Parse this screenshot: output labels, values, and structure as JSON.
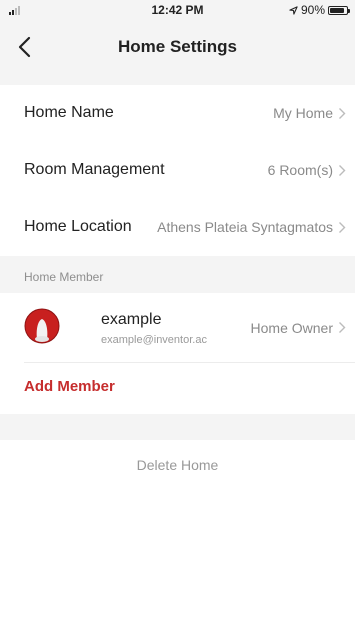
{
  "status_bar": {
    "time": "12:42 PM",
    "battery_text": "90%",
    "battery_level": 0.9,
    "location_icon": "location-arrow-icon",
    "signal_icon": "cellular-signal-icon"
  },
  "nav": {
    "title": "Home Settings",
    "back_icon": "chevron-left-icon"
  },
  "settings": [
    {
      "label": "Home Name",
      "value": "My Home"
    },
    {
      "label": "Room Management",
      "value": "6 Room(s)"
    },
    {
      "label": "Home Location",
      "value": "Athens Plateia Syntagmatos"
    }
  ],
  "members_section": {
    "header": "Home Member",
    "members": [
      {
        "name": "example",
        "email": "example@inventor.ac",
        "role": "Home Owner",
        "avatar_icon": "avatar-icon"
      }
    ],
    "add_label": "Add Member"
  },
  "delete_label": "Delete Home",
  "colors": {
    "accent": "#c62d2d",
    "background": "#f4f4f4",
    "card": "#ffffff",
    "secondary_text": "#8a8a8a"
  }
}
